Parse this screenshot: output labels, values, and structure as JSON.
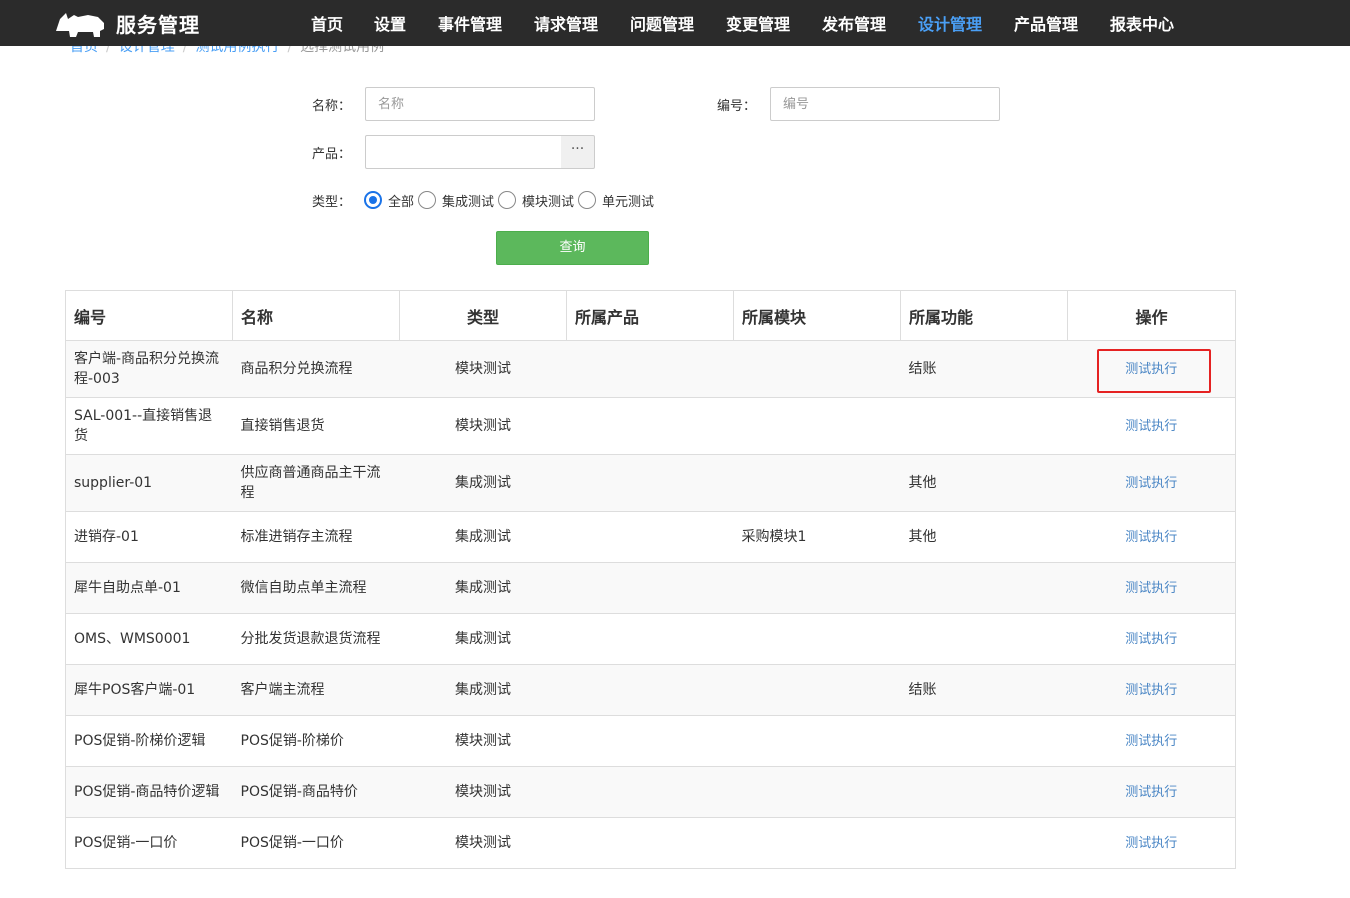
{
  "app": {
    "brand": "服务管理"
  },
  "nav": [
    {
      "label": "首页",
      "active": false
    },
    {
      "label": "设置",
      "active": false
    },
    {
      "label": "事件管理",
      "active": false
    },
    {
      "label": "请求管理",
      "active": false
    },
    {
      "label": "问题管理",
      "active": false
    },
    {
      "label": "变更管理",
      "active": false
    },
    {
      "label": "发布管理",
      "active": false
    },
    {
      "label": "设计管理",
      "active": true
    },
    {
      "label": "产品管理",
      "active": false
    },
    {
      "label": "报表中心",
      "active": false
    }
  ],
  "breadcrumb": [
    "首页",
    "设计管理",
    "测试用例执行",
    "选择测试用例"
  ],
  "form": {
    "name_label": "名称：",
    "name_placeholder": "名称",
    "code_label": "编号：",
    "code_placeholder": "编号",
    "product_label": "产品：",
    "product_value": "",
    "picker_glyph": "···",
    "type_label": "类型：",
    "type_options": [
      {
        "label": "全部",
        "checked": true
      },
      {
        "label": "集成测试",
        "checked": false
      },
      {
        "label": "模块测试",
        "checked": false
      },
      {
        "label": "单元测试",
        "checked": false
      }
    ],
    "query_label": "查询"
  },
  "table": {
    "columns": [
      "编号",
      "名称",
      "类型",
      "所属产品",
      "所属模块",
      "所属功能",
      "操作"
    ],
    "rows": [
      {
        "code": "客户端-商品积分兑换流程-003",
        "name": "商品积分兑换流程",
        "type": "模块测试",
        "product": "",
        "module": "",
        "function": "结账",
        "action": "测试执行"
      },
      {
        "code": "SAL-001--直接销售退货",
        "name": "直接销售退货",
        "type": "模块测试",
        "product": "",
        "module": "",
        "function": "",
        "action": "测试执行"
      },
      {
        "code": "supplier-01",
        "name": "供应商普通商品主干流程",
        "type": "集成测试",
        "product": "",
        "module": "",
        "function": "其他",
        "action": "测试执行"
      },
      {
        "code": "进销存-01",
        "name": "标准进销存主流程",
        "type": "集成测试",
        "product": "",
        "module": "采购模块1",
        "function": "其他",
        "action": "测试执行"
      },
      {
        "code": "犀牛自助点单-01",
        "name": "微信自助点单主流程",
        "type": "集成测试",
        "product": "",
        "module": "",
        "function": "",
        "action": "测试执行"
      },
      {
        "code": "OMS、WMS0001",
        "name": "分批发货退款退货流程",
        "type": "集成测试",
        "product": "",
        "module": "",
        "function": "",
        "action": "测试执行"
      },
      {
        "code": "犀牛POS客户端-01",
        "name": "客户端主流程",
        "type": "集成测试",
        "product": "",
        "module": "",
        "function": "结账",
        "action": "测试执行"
      },
      {
        "code": "POS促销-阶梯价逻辑",
        "name": "POS促销-阶梯价",
        "type": "模块测试",
        "product": "",
        "module": "",
        "function": "",
        "action": "测试执行"
      },
      {
        "code": "POS促销-商品特价逻辑",
        "name": "POS促销-商品特价",
        "type": "模块测试",
        "product": "",
        "module": "",
        "function": "",
        "action": "测试执行"
      },
      {
        "code": "POS促销-一口价",
        "name": "POS促销-一口价",
        "type": "模块测试",
        "product": "",
        "module": "",
        "function": "",
        "action": "测试执行"
      }
    ]
  },
  "colors": {
    "navbar_bg": "#2b2b2b",
    "nav_active": "#4a9ff5",
    "link": "#4a86c5",
    "query_button": "#5cb85c",
    "highlight": "#e52222"
  }
}
